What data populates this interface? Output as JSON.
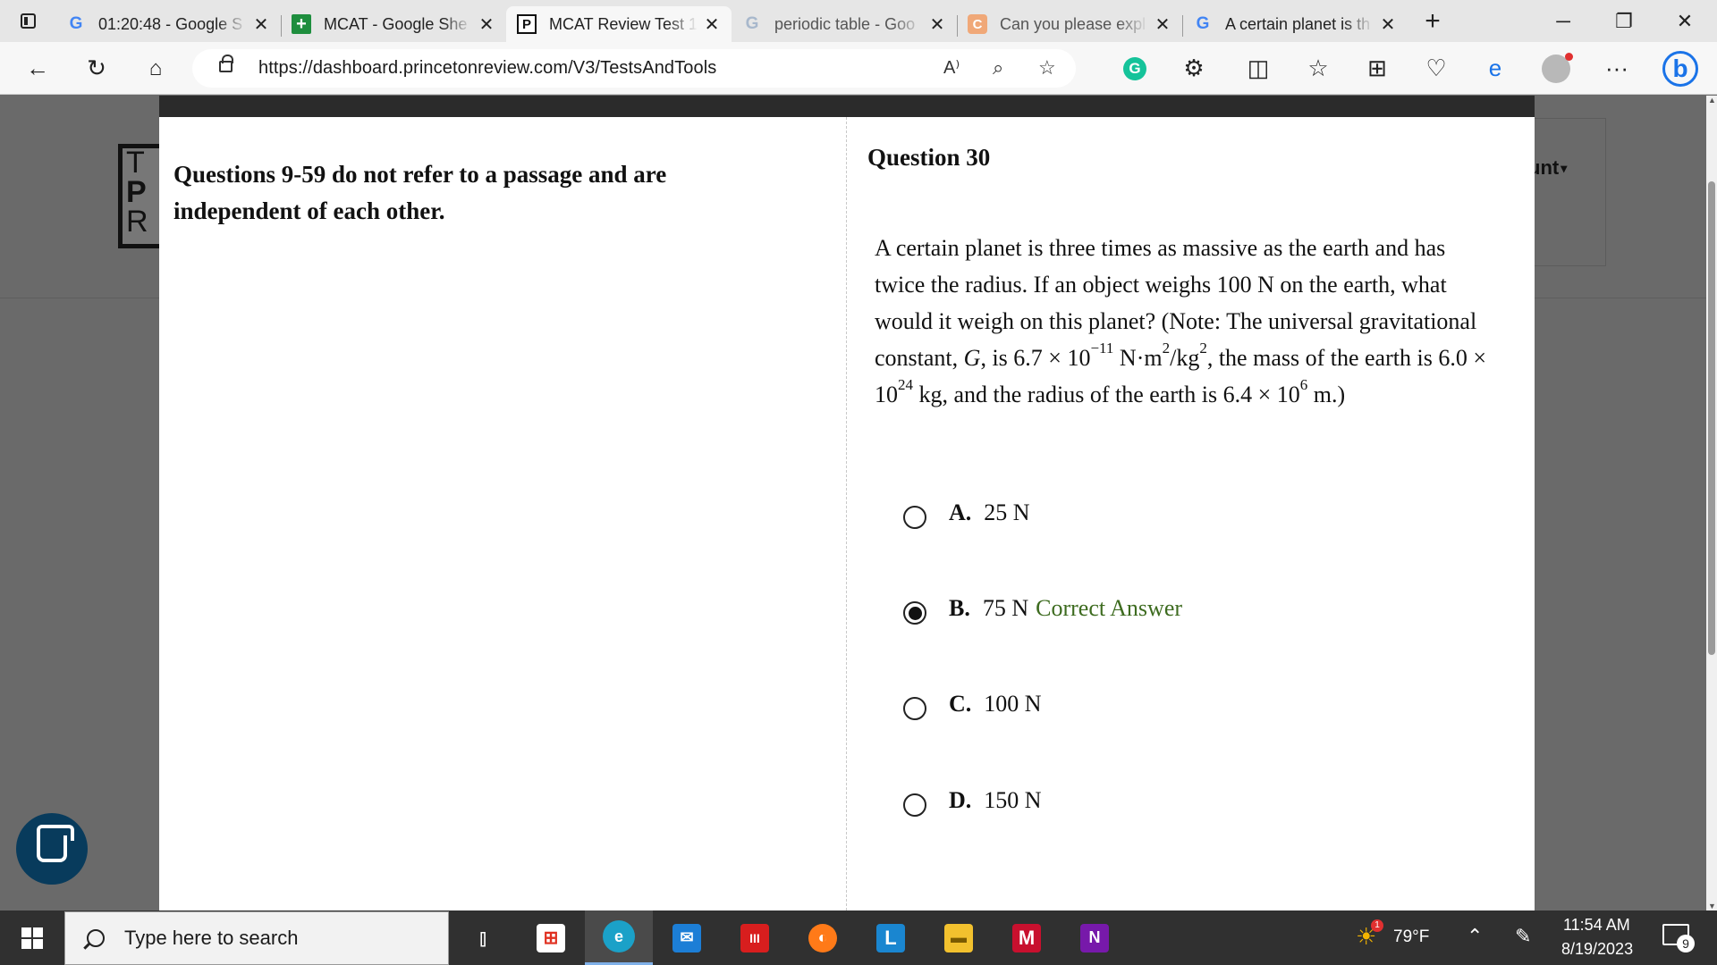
{
  "tabs": [
    {
      "title": "01:20:48 - Google S",
      "favicon": "google-icon"
    },
    {
      "title": "MCAT - Google She",
      "favicon": "sheets-icon"
    },
    {
      "title": "MCAT Review Test 1",
      "favicon": "princeton-review-icon",
      "active": true
    },
    {
      "title": "periodic table - Goo",
      "favicon": "google-icon"
    },
    {
      "title": "Can you please expl",
      "favicon": "chegg-icon"
    },
    {
      "title": "A certain planet is th",
      "favicon": "google-icon"
    }
  ],
  "toolbar": {
    "url": "https://dashboard.princetonreview.com/V3/TestsAndTools"
  },
  "page": {
    "logo_letters": [
      "T",
      "P",
      "R"
    ],
    "account_label": "unt",
    "intro": "Questions 9-59 do not refer to a passage and are independent of each other.",
    "question_number": "Question 30",
    "stem": {
      "p1": "A certain planet is three times as massive as the earth and has twice the radius. If an object weighs 100 N on the earth, what would it weigh on this planet? (Note: The universal gravitational constant, ",
      "g": "G",
      "p2": ", is 6.7 × 10",
      "exp1": "−11",
      "p3": " N·m",
      "exp2": "2",
      "p4": "/kg",
      "exp3": "2",
      "p5": ", the mass of the earth is 6.0 × 10",
      "exp4": "24",
      "p6": " kg, and the radius of the earth is 6.4 × 10",
      "exp5": "6",
      "p7": " m.)"
    },
    "choices": [
      {
        "letter": "A.",
        "text": "25 N",
        "selected": false,
        "note": ""
      },
      {
        "letter": "B.",
        "text": "75 N",
        "selected": true,
        "note": "Correct Answer"
      },
      {
        "letter": "C.",
        "text": "100 N",
        "selected": false,
        "note": ""
      },
      {
        "letter": "D.",
        "text": "150 N",
        "selected": false,
        "note": ""
      }
    ]
  },
  "taskbar": {
    "search_placeholder": "Type here to search",
    "weather": "79°F",
    "time": "11:54 AM",
    "date": "8/19/2023",
    "notification_count": "9",
    "weather_badge": "1",
    "apps": [
      "task-view-icon",
      "store-icon",
      "edge-icon",
      "mail-icon",
      "mcafee-app-icon",
      "firefox-icon",
      "lexia-icon",
      "file-explorer-icon",
      "mcafee-icon",
      "onenote-icon"
    ]
  },
  "colors": {
    "correct_answer": "#3d6b1f",
    "page_dim": "#6a6a6a",
    "taskbar": "#303030"
  }
}
